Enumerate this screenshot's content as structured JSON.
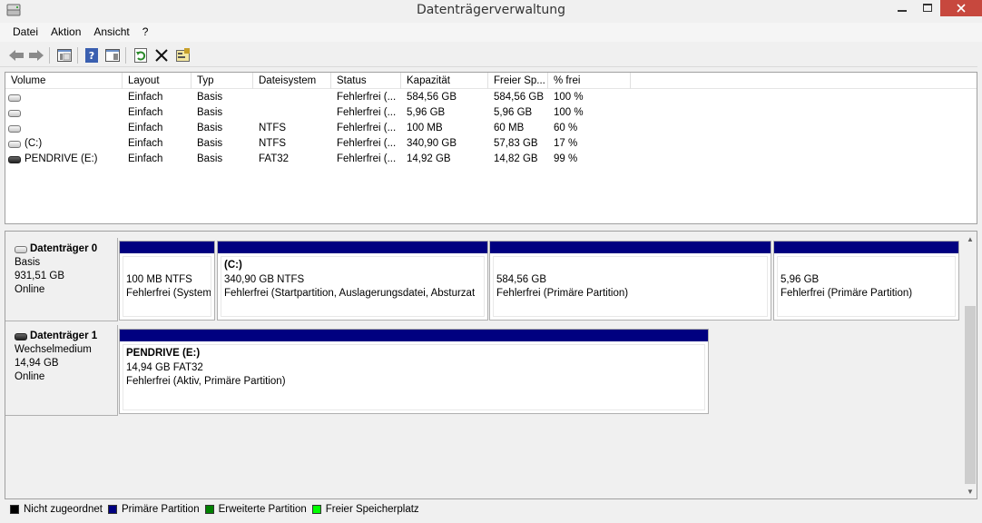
{
  "window": {
    "title": "Datenträgerverwaltung",
    "colors": {
      "close": "#c7483e"
    }
  },
  "menu": [
    "Datei",
    "Aktion",
    "Ansicht",
    "?"
  ],
  "toolbar": [
    "back-arrow-icon",
    "forward-arrow-icon",
    "properties-icon",
    "help-icon",
    "show-hide-icon",
    "refresh-icon",
    "delete-icon",
    "settings-icon"
  ],
  "volume_list": {
    "columns": [
      "Volume",
      "Layout",
      "Typ",
      "Dateisystem",
      "Status",
      "Kapazität",
      "Freier Sp...",
      "% frei"
    ],
    "rows": [
      {
        "volume": "",
        "layout": "Einfach",
        "typ": "Basis",
        "fs": "",
        "status": "Fehlerfrei (...",
        "kap": "584,56 GB",
        "frei": "584,56 GB",
        "pct": "100 %",
        "icon": "hdd"
      },
      {
        "volume": "",
        "layout": "Einfach",
        "typ": "Basis",
        "fs": "",
        "status": "Fehlerfrei (...",
        "kap": "5,96 GB",
        "frei": "5,96 GB",
        "pct": "100 %",
        "icon": "hdd"
      },
      {
        "volume": "",
        "layout": "Einfach",
        "typ": "Basis",
        "fs": "NTFS",
        "status": "Fehlerfrei (...",
        "kap": "100 MB",
        "frei": "60 MB",
        "pct": "60 %",
        "icon": "hdd"
      },
      {
        "volume": "(C:)",
        "layout": "Einfach",
        "typ": "Basis",
        "fs": "NTFS",
        "status": "Fehlerfrei (...",
        "kap": "340,90 GB",
        "frei": "57,83 GB",
        "pct": "17 %",
        "icon": "hdd"
      },
      {
        "volume": "PENDRIVE (E:)",
        "layout": "Einfach",
        "typ": "Basis",
        "fs": "FAT32",
        "status": "Fehlerfrei (...",
        "kap": "14,92 GB",
        "frei": "14,82 GB",
        "pct": "99 %",
        "icon": "usb"
      }
    ]
  },
  "disks": [
    {
      "name": "Datenträger 0",
      "type": "Basis",
      "size": "931,51 GB",
      "state": "Online",
      "partitions": [
        {
          "name": "",
          "line1": "100 MB NTFS",
          "line2": "Fehlerfrei (System"
        },
        {
          "name": "(C:)",
          "line1": "340,90 GB NTFS",
          "line2": "Fehlerfrei (Startpartition, Auslagerungsdatei, Absturzat"
        },
        {
          "name": "",
          "line1": "584,56 GB",
          "line2": "Fehlerfrei (Primäre Partition)"
        },
        {
          "name": "",
          "line1": "5,96 GB",
          "line2": "Fehlerfrei (Primäre Partition)"
        }
      ]
    },
    {
      "name": "Datenträger 1",
      "type": "Wechselmedium",
      "size": "14,94 GB",
      "state": "Online",
      "partitions": [
        {
          "name": "PENDRIVE  (E:)",
          "line1": "14,94 GB FAT32",
          "line2": "Fehlerfrei (Aktiv, Primäre Partition)"
        }
      ]
    }
  ],
  "legend": [
    {
      "label": "Nicht zugeordnet",
      "color": "#000000"
    },
    {
      "label": "Primäre Partition",
      "color": "#000080"
    },
    {
      "label": "Erweiterte Partition",
      "color": "#008000"
    },
    {
      "label": "Freier Speicherplatz",
      "color": "#00ff00"
    }
  ]
}
